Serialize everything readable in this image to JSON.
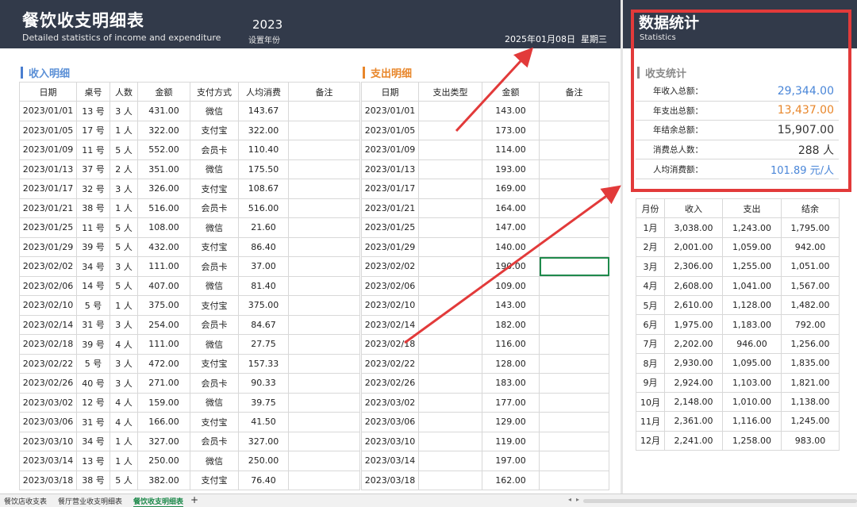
{
  "header": {
    "title": "餐饮收支明细表",
    "subtitle": "Detailed statistics of income and expenditure",
    "year": "2023",
    "year_label": "设置年份",
    "date": "2025年01月08日",
    "weekday": "星期三",
    "stats_title": "数据统计",
    "stats_subtitle": "Statistics"
  },
  "income": {
    "section_title": "收入明细",
    "columns": [
      "日期",
      "桌号",
      "人数",
      "金额",
      "支付方式",
      "人均消费",
      "备注"
    ],
    "rows": [
      [
        "2023/01/01",
        "13 号",
        "3 人",
        "431.00",
        "微信",
        "143.67",
        ""
      ],
      [
        "2023/01/05",
        "17 号",
        "1 人",
        "322.00",
        "支付宝",
        "322.00",
        ""
      ],
      [
        "2023/01/09",
        "11 号",
        "5 人",
        "552.00",
        "会员卡",
        "110.40",
        ""
      ],
      [
        "2023/01/13",
        "37 号",
        "2 人",
        "351.00",
        "微信",
        "175.50",
        ""
      ],
      [
        "2023/01/17",
        "32 号",
        "3 人",
        "326.00",
        "支付宝",
        "108.67",
        ""
      ],
      [
        "2023/01/21",
        "38 号",
        "1 人",
        "516.00",
        "会员卡",
        "516.00",
        ""
      ],
      [
        "2023/01/25",
        "11 号",
        "5 人",
        "108.00",
        "微信",
        "21.60",
        ""
      ],
      [
        "2023/01/29",
        "39 号",
        "5 人",
        "432.00",
        "支付宝",
        "86.40",
        ""
      ],
      [
        "2023/02/02",
        "34 号",
        "3 人",
        "111.00",
        "会员卡",
        "37.00",
        ""
      ],
      [
        "2023/02/06",
        "14 号",
        "5 人",
        "407.00",
        "微信",
        "81.40",
        ""
      ],
      [
        "2023/02/10",
        "5 号",
        "1 人",
        "375.00",
        "支付宝",
        "375.00",
        ""
      ],
      [
        "2023/02/14",
        "31 号",
        "3 人",
        "254.00",
        "会员卡",
        "84.67",
        ""
      ],
      [
        "2023/02/18",
        "39 号",
        "4 人",
        "111.00",
        "微信",
        "27.75",
        ""
      ],
      [
        "2023/02/22",
        "5 号",
        "3 人",
        "472.00",
        "支付宝",
        "157.33",
        ""
      ],
      [
        "2023/02/26",
        "40 号",
        "3 人",
        "271.00",
        "会员卡",
        "90.33",
        ""
      ],
      [
        "2023/03/02",
        "12 号",
        "4 人",
        "159.00",
        "微信",
        "39.75",
        ""
      ],
      [
        "2023/03/06",
        "31 号",
        "4 人",
        "166.00",
        "支付宝",
        "41.50",
        ""
      ],
      [
        "2023/03/10",
        "34 号",
        "1 人",
        "327.00",
        "会员卡",
        "327.00",
        ""
      ],
      [
        "2023/03/14",
        "13 号",
        "1 人",
        "250.00",
        "微信",
        "250.00",
        ""
      ],
      [
        "2023/03/18",
        "38 号",
        "5 人",
        "382.00",
        "支付宝",
        "76.40",
        ""
      ]
    ]
  },
  "expense": {
    "section_title": "支出明细",
    "columns": [
      "日期",
      "支出类型",
      "金额",
      "备注"
    ],
    "rows": [
      [
        "2023/01/01",
        "",
        "143.00",
        ""
      ],
      [
        "2023/01/05",
        "",
        "173.00",
        ""
      ],
      [
        "2023/01/09",
        "",
        "114.00",
        ""
      ],
      [
        "2023/01/13",
        "",
        "193.00",
        ""
      ],
      [
        "2023/01/17",
        "",
        "169.00",
        ""
      ],
      [
        "2023/01/21",
        "",
        "164.00",
        ""
      ],
      [
        "2023/01/25",
        "",
        "147.00",
        ""
      ],
      [
        "2023/01/29",
        "",
        "140.00",
        ""
      ],
      [
        "2023/02/02",
        "",
        "190.00",
        ""
      ],
      [
        "2023/02/06",
        "",
        "109.00",
        ""
      ],
      [
        "2023/02/10",
        "",
        "143.00",
        ""
      ],
      [
        "2023/02/14",
        "",
        "182.00",
        ""
      ],
      [
        "2023/02/18",
        "",
        "116.00",
        ""
      ],
      [
        "2023/02/22",
        "",
        "128.00",
        ""
      ],
      [
        "2023/02/26",
        "",
        "183.00",
        ""
      ],
      [
        "2023/03/02",
        "",
        "177.00",
        ""
      ],
      [
        "2023/03/06",
        "",
        "129.00",
        ""
      ],
      [
        "2023/03/10",
        "",
        "119.00",
        ""
      ],
      [
        "2023/03/14",
        "",
        "197.00",
        ""
      ],
      [
        "2023/03/18",
        "",
        "162.00",
        ""
      ]
    ]
  },
  "summary": {
    "section_title": "收支统计",
    "items": [
      {
        "label": "年收入总额：",
        "value": "29,344.00"
      },
      {
        "label": "年支出总额：",
        "value": "13,437.00"
      },
      {
        "label": "年结余总额：",
        "value": "15,907.00"
      },
      {
        "label": "消费总人数：",
        "value": "288 人"
      },
      {
        "label": "人均消费额：",
        "value": "101.89 元/人"
      }
    ]
  },
  "monthly": {
    "columns": [
      "月份",
      "收入",
      "支出",
      "结余"
    ],
    "rows": [
      [
        "1月",
        "3,038.00",
        "1,243.00",
        "1,795.00"
      ],
      [
        "2月",
        "2,001.00",
        "1,059.00",
        "942.00"
      ],
      [
        "3月",
        "2,306.00",
        "1,255.00",
        "1,051.00"
      ],
      [
        "4月",
        "2,608.00",
        "1,041.00",
        "1,567.00"
      ],
      [
        "5月",
        "2,610.00",
        "1,128.00",
        "1,482.00"
      ],
      [
        "6月",
        "1,975.00",
        "1,183.00",
        "792.00"
      ],
      [
        "7月",
        "2,202.00",
        "946.00",
        "1,256.00"
      ],
      [
        "8月",
        "2,930.00",
        "1,095.00",
        "1,835.00"
      ],
      [
        "9月",
        "2,924.00",
        "1,103.00",
        "1,821.00"
      ],
      [
        "10月",
        "2,148.00",
        "1,010.00",
        "1,138.00"
      ],
      [
        "11月",
        "2,361.00",
        "1,116.00",
        "1,245.00"
      ],
      [
        "12月",
        "2,241.00",
        "1,258.00",
        "983.00"
      ]
    ]
  },
  "sheet_tabs": [
    {
      "label": "餐饮店收支表",
      "active": false
    },
    {
      "label": "餐厅营业收支明细表",
      "active": false
    },
    {
      "label": "餐饮收支明细表",
      "active": true
    }
  ],
  "add_tab_label": "+",
  "colors": {
    "header_bg": "#323a4a",
    "income_accent": "#4a7ed0",
    "expense_accent": "#e8862a",
    "highlight": "#e23a3a",
    "selection": "#1f8a4c"
  }
}
